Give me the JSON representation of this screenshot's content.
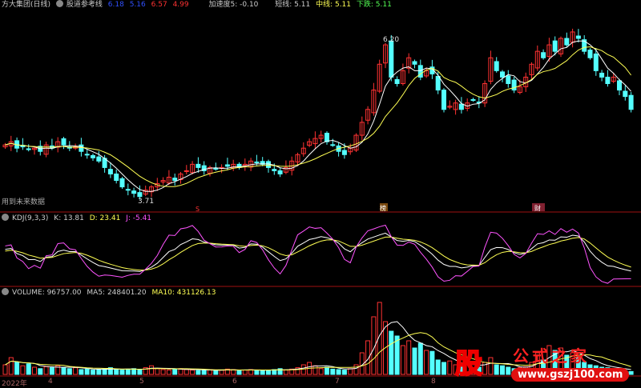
{
  "header": {
    "title": "方大集团(日线)",
    "indicator": "股道参考线",
    "v1": "6.18",
    "v2": "5.16",
    "v3": "6.57",
    "v4": "4.99",
    "accel": "加速度5: -0.10",
    "short": "短线: 5.11",
    "mid": "中线: 5.11",
    "down": "下跌: 5.11"
  },
  "main": {
    "note": "用到未来数据",
    "high_label": "6.20",
    "low_label": "3.71",
    "markers": [
      "S",
      "榜",
      "财"
    ]
  },
  "kdj": {
    "title": "KDJ(9,3,3)",
    "k": "K: 13.81",
    "d": "D: 23.41",
    "j": "J: -5.41"
  },
  "volume": {
    "title": "VOLUME: 96757.00",
    "ma5": "MA5: 248401.20",
    "ma10": "MA10: 431126.13"
  },
  "xaxis": [
    "2022年",
    "4",
    "5",
    "6",
    "7",
    "8"
  ],
  "logo": {
    "char": "股",
    "name": "公式之家",
    "url": "www.gszj100.com"
  },
  "colors": {
    "up": "#ff3232",
    "down": "#54ffff",
    "ma1": "#ffffff",
    "ma2": "#ffff54",
    "k": "#ffffff",
    "d": "#ffff54",
    "j": "#ff54ff"
  },
  "chart_data": {
    "type": "candlestick",
    "closes": [
      4.55,
      4.6,
      4.5,
      4.52,
      4.48,
      4.5,
      4.45,
      4.55,
      4.5,
      4.6,
      4.55,
      4.5,
      4.52,
      4.45,
      4.4,
      4.35,
      4.3,
      4.2,
      4.1,
      4.0,
      3.9,
      3.85,
      3.8,
      3.75,
      3.85,
      3.9,
      3.95,
      4.0,
      4.05,
      4.0,
      4.1,
      4.15,
      4.25,
      4.2,
      4.15,
      4.2,
      4.18,
      4.2,
      4.22,
      4.25,
      4.2,
      4.25,
      4.3,
      4.28,
      4.25,
      4.2,
      4.15,
      4.1,
      4.2,
      4.3,
      4.4,
      4.5,
      4.6,
      4.65,
      4.7,
      4.6,
      4.55,
      4.45,
      4.4,
      4.5,
      4.7,
      4.9,
      5.1,
      5.4,
      5.8,
      6.1,
      5.6,
      5.5,
      5.7,
      5.9,
      5.8,
      5.6,
      5.7,
      5.65,
      5.4,
      5.1,
      5.15,
      5.2,
      5.1,
      5.2,
      5.25,
      5.2,
      5.5,
      5.9,
      5.7,
      5.6,
      5.5,
      5.4,
      5.45,
      5.6,
      5.8,
      6.0,
      5.9,
      6.1,
      6.0,
      6.2,
      6.1,
      6.3,
      6.2,
      6.0,
      5.9,
      5.7,
      5.6,
      5.5,
      5.6,
      5.4,
      5.3,
      5.1
    ],
    "volumes": [
      20,
      35,
      25,
      18,
      22,
      15,
      12,
      16,
      14,
      18,
      15,
      12,
      14,
      10,
      11,
      9,
      10,
      12,
      14,
      10,
      9,
      11,
      12,
      10,
      14,
      18,
      12,
      10,
      9,
      11,
      12,
      10,
      9,
      8,
      9,
      10,
      8,
      9,
      11,
      10,
      8,
      9,
      10,
      9,
      8,
      9,
      10,
      12,
      9,
      11,
      14,
      20,
      25,
      18,
      12,
      15,
      11,
      10,
      9,
      12,
      20,
      45,
      70,
      120,
      150,
      110,
      90,
      80,
      60,
      70,
      55,
      65,
      50,
      48,
      30,
      25,
      28,
      20,
      18,
      22,
      20,
      15,
      25,
      35,
      20,
      18,
      15,
      12,
      14,
      16,
      25,
      45,
      30,
      60,
      50,
      55,
      40,
      45,
      35,
      25,
      20,
      18,
      15,
      14,
      12,
      10,
      8,
      6
    ]
  }
}
